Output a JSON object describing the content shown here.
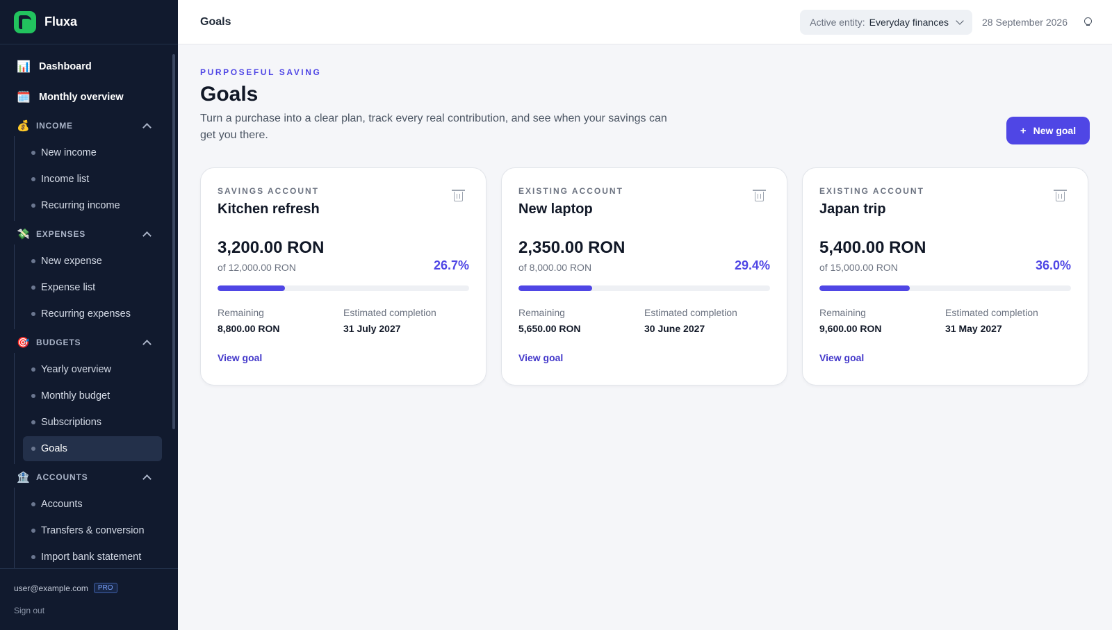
{
  "app": {
    "name": "Fluxa"
  },
  "sidebar": {
    "top_items": [
      {
        "label": "Dashboard",
        "icon": "📊"
      },
      {
        "label": "Monthly overview",
        "icon": "🗓️"
      }
    ],
    "sections": [
      {
        "label": "INCOME",
        "icon": "💰",
        "items": [
          "New income",
          "Income list",
          "Recurring income"
        ]
      },
      {
        "label": "EXPENSES",
        "icon": "💸",
        "items": [
          "New expense",
          "Expense list",
          "Recurring expenses"
        ]
      },
      {
        "label": "BUDGETS",
        "icon": "🎯",
        "items": [
          "Yearly overview",
          "Monthly budget",
          "Subscriptions",
          "Goals"
        ]
      },
      {
        "label": "ACCOUNTS",
        "icon": "🏦",
        "items": [
          "Accounts",
          "Transfers & conversion",
          "Import bank statement"
        ]
      }
    ],
    "active_item": "Goals",
    "footer": {
      "email": "user@example.com",
      "badge": "PRO",
      "sign_out": "Sign out"
    }
  },
  "topbar": {
    "title": "Goals",
    "entity_label": "Active entity:",
    "entity_value": "Everyday finances",
    "date": "28 September 2026"
  },
  "main": {
    "eyebrow": "PURPOSEFUL SAVING",
    "title": "Goals",
    "description": "Turn a purchase into a clear plan, track every real contribution, and see when your savings can get you there.",
    "new_goal_plus": "+",
    "new_goal_label": "New goal",
    "remaining_label": "Remaining",
    "completion_label": "Estimated completion",
    "view_label": "View goal"
  },
  "colors": {
    "accent": "#4f46e5",
    "sidebar_bg": "#111a2e",
    "brand_green": "#22c35e"
  },
  "goals": [
    {
      "account": "SAVINGS ACCOUNT",
      "name": "Kitchen refresh",
      "saved": "3,200.00 RON",
      "target": "of 12,000.00 RON",
      "percent": "26.7%",
      "progress": 0.267,
      "remaining": "8,800.00 RON",
      "completion": "31 July 2027"
    },
    {
      "account": "EXISTING ACCOUNT",
      "name": "New laptop",
      "saved": "2,350.00 RON",
      "target": "of 8,000.00 RON",
      "percent": "29.4%",
      "progress": 0.294,
      "remaining": "5,650.00 RON",
      "completion": "30 June 2027"
    },
    {
      "account": "EXISTING ACCOUNT",
      "name": "Japan trip",
      "saved": "5,400.00 RON",
      "target": "of 15,000.00 RON",
      "percent": "36.0%",
      "progress": 0.36,
      "remaining": "9,600.00 RON",
      "completion": "31 May 2027"
    }
  ]
}
